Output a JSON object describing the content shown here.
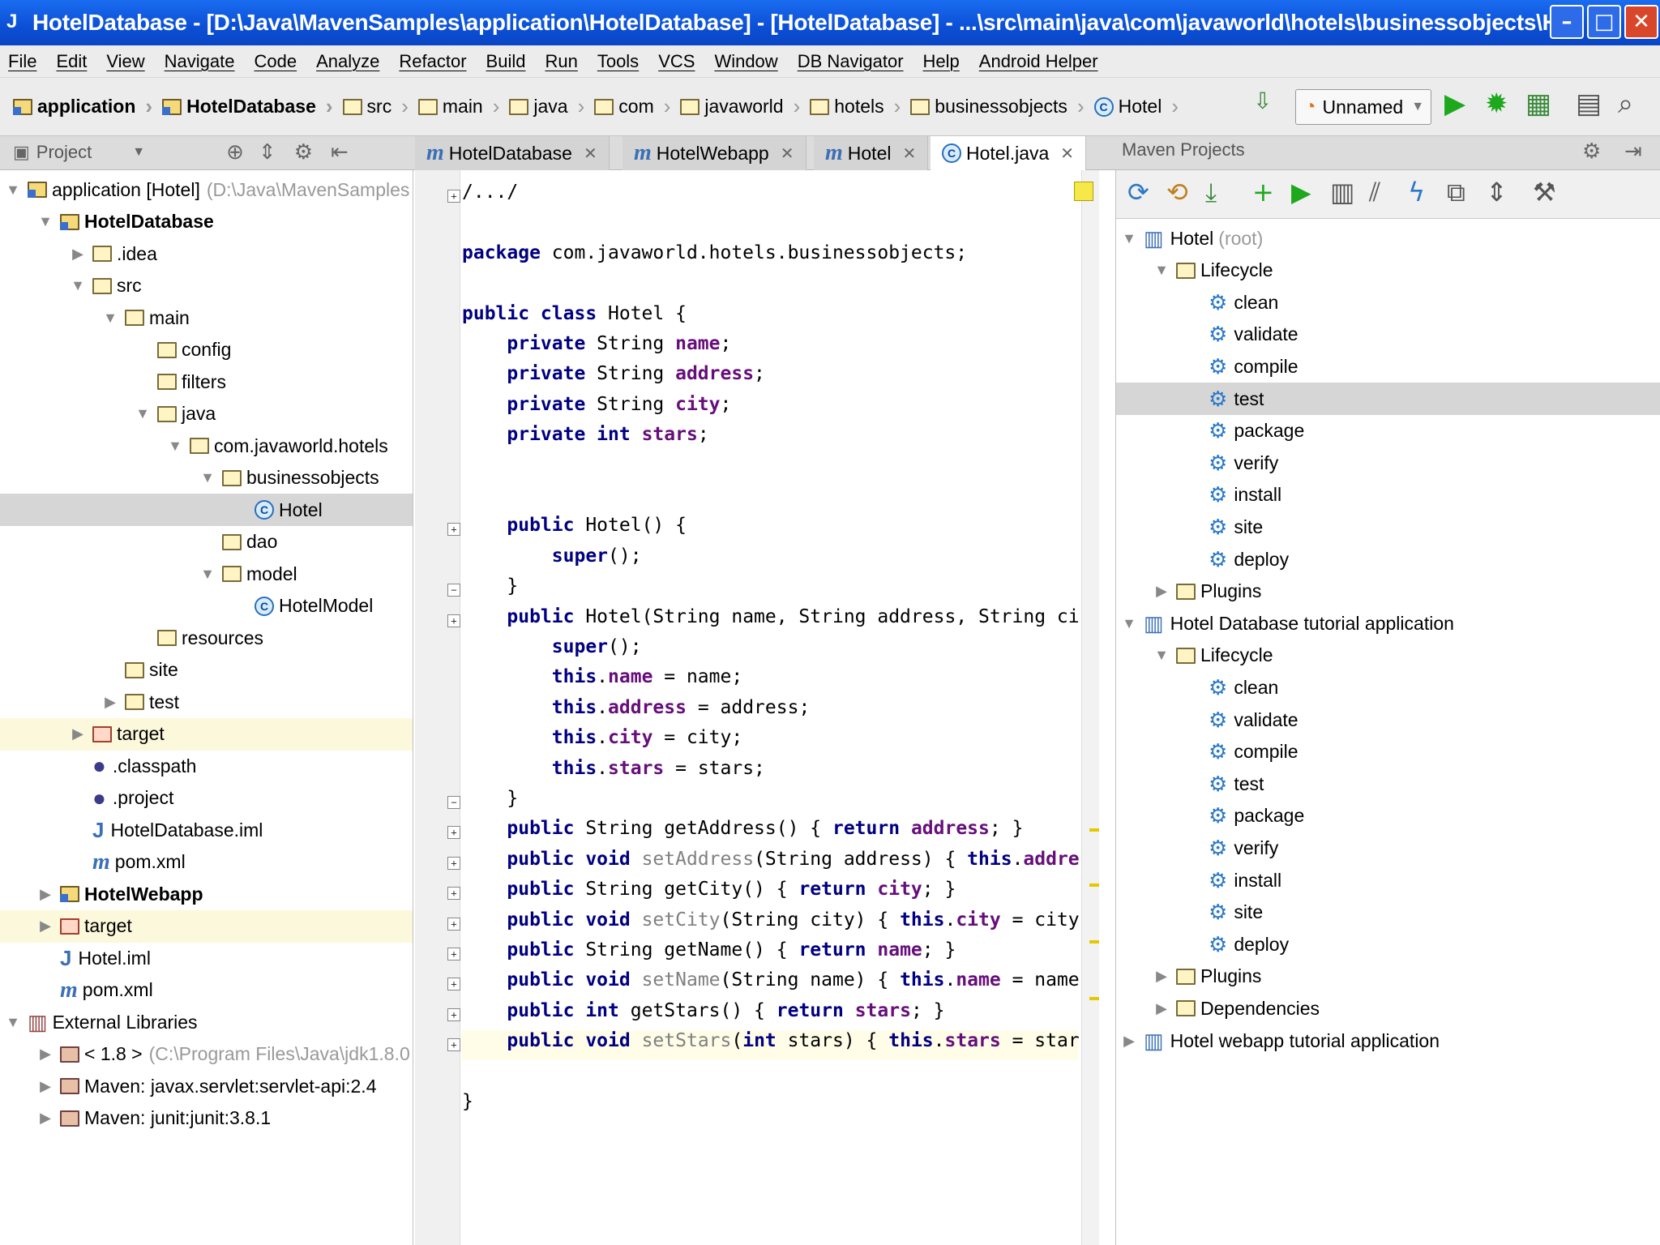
{
  "window": {
    "title": "HotelDatabase - [D:\\Java\\MavenSamples\\application\\HotelDatabase] - [HotelDatabase] - ...\\src\\main\\java\\com\\javaworld\\hotels\\businessobjects\\Hot...",
    "minimize": "–",
    "maximize": "□",
    "close": "✕"
  },
  "menu": [
    "File",
    "Edit",
    "View",
    "Navigate",
    "Code",
    "Analyze",
    "Refactor",
    "Build",
    "Run",
    "Tools",
    "VCS",
    "Window",
    "DB Navigator",
    "Help",
    "Android Helper"
  ],
  "breadcrumbs": [
    "application",
    "HotelDatabase",
    "src",
    "main",
    "java",
    "com",
    "javaworld",
    "hotels",
    "businessobjects",
    "Hotel"
  ],
  "run_config": "Unnamed",
  "project_panel": {
    "title": "Project"
  },
  "tabs": [
    {
      "label": "HotelDatabase",
      "icon": "maven-m"
    },
    {
      "label": "HotelWebapp",
      "icon": "maven-m"
    },
    {
      "label": "Hotel",
      "icon": "maven-m"
    },
    {
      "label": "Hotel.java",
      "icon": "class-c"
    }
  ],
  "maven_panel": {
    "title": "Maven Projects"
  },
  "tree": [
    {
      "label": "application [Hotel]",
      "extra": "(D:\\Java\\MavenSamples",
      "indent": 0,
      "arrow": "open",
      "icon": "module-folder"
    },
    {
      "label": "HotelDatabase",
      "indent": 1,
      "arrow": "open",
      "icon": "module-folder",
      "bold": true
    },
    {
      "label": ".idea",
      "indent": 2,
      "arrow": "closed",
      "icon": "folder"
    },
    {
      "label": "src",
      "indent": 2,
      "arrow": "open",
      "icon": "folder"
    },
    {
      "label": "main",
      "indent": 3,
      "arrow": "open",
      "icon": "folder"
    },
    {
      "label": "config",
      "indent": 4,
      "arrow": "none",
      "icon": "folder"
    },
    {
      "label": "filters",
      "indent": 4,
      "arrow": "none",
      "icon": "folder"
    },
    {
      "label": "java",
      "indent": 4,
      "arrow": "open",
      "icon": "folder"
    },
    {
      "label": "com.javaworld.hotels",
      "indent": 5,
      "arrow": "open",
      "icon": "folder"
    },
    {
      "label": "businessobjects",
      "indent": 6,
      "arrow": "open",
      "icon": "folder"
    },
    {
      "label": "Hotel",
      "indent": 7,
      "arrow": "none",
      "icon": "class",
      "selected": true
    },
    {
      "label": "dao",
      "indent": 6,
      "arrow": "none",
      "icon": "folder"
    },
    {
      "label": "model",
      "indent": 6,
      "arrow": "open",
      "icon": "folder"
    },
    {
      "label": "HotelModel",
      "indent": 7,
      "arrow": "none",
      "icon": "class"
    },
    {
      "label": "resources",
      "indent": 4,
      "arrow": "none",
      "icon": "folder"
    },
    {
      "label": "site",
      "indent": 3,
      "arrow": "none",
      "icon": "folder"
    },
    {
      "label": "test",
      "indent": 3,
      "arrow": "closed",
      "icon": "folder"
    },
    {
      "label": "target",
      "indent": 2,
      "arrow": "closed",
      "icon": "red-folder",
      "highlight": true
    },
    {
      "label": ".classpath",
      "indent": 2,
      "arrow": "none",
      "icon": "eclipse"
    },
    {
      "label": ".project",
      "indent": 2,
      "arrow": "none",
      "icon": "eclipse"
    },
    {
      "label": "HotelDatabase.iml",
      "indent": 2,
      "arrow": "none",
      "icon": "iml"
    },
    {
      "label": "pom.xml",
      "indent": 2,
      "arrow": "none",
      "icon": "maven"
    },
    {
      "label": "HotelWebapp",
      "indent": 1,
      "arrow": "closed",
      "icon": "module-folder",
      "bold": true
    },
    {
      "label": "target",
      "indent": 1,
      "arrow": "closed",
      "icon": "red-folder",
      "highlight": true
    },
    {
      "label": "Hotel.iml",
      "indent": 1,
      "arrow": "none",
      "icon": "iml"
    },
    {
      "label": "pom.xml",
      "indent": 1,
      "arrow": "none",
      "icon": "maven"
    },
    {
      "label": "External Libraries",
      "indent": 0,
      "arrow": "open",
      "icon": "libs"
    },
    {
      "label": "< 1.8 >",
      "extra": "(C:\\Program Files\\Java\\jdk1.8.0",
      "indent": 1,
      "arrow": "closed",
      "icon": "lib"
    },
    {
      "label": "Maven: javax.servlet:servlet-api:2.4",
      "indent": 1,
      "arrow": "closed",
      "icon": "lib"
    },
    {
      "label": "Maven: junit:junit:3.8.1",
      "indent": 1,
      "arrow": "closed",
      "icon": "lib"
    }
  ],
  "code": [
    [
      [
        "p",
        "/.../"
      ]
    ],
    [],
    [
      [
        "k",
        "package"
      ],
      [
        "p",
        " com.javaworld.hotels.businessobjects;"
      ]
    ],
    [],
    [
      [
        "k",
        "public class"
      ],
      [
        "p",
        " Hotel {"
      ]
    ],
    [
      [
        "p",
        "    "
      ],
      [
        "k",
        "private"
      ],
      [
        "p",
        " String "
      ],
      [
        "f",
        "name"
      ],
      [
        "p",
        ";"
      ]
    ],
    [
      [
        "p",
        "    "
      ],
      [
        "k",
        "private"
      ],
      [
        "p",
        " String "
      ],
      [
        "f",
        "address"
      ],
      [
        "p",
        ";"
      ]
    ],
    [
      [
        "p",
        "    "
      ],
      [
        "k",
        "private"
      ],
      [
        "p",
        " String "
      ],
      [
        "f",
        "city"
      ],
      [
        "p",
        ";"
      ]
    ],
    [
      [
        "p",
        "    "
      ],
      [
        "k",
        "private int"
      ],
      [
        "p",
        " "
      ],
      [
        "f",
        "stars"
      ],
      [
        "p",
        ";"
      ]
    ],
    [],
    [],
    [
      [
        "p",
        "    "
      ],
      [
        "k",
        "public"
      ],
      [
        "p",
        " Hotel() {"
      ]
    ],
    [
      [
        "p",
        "        "
      ],
      [
        "k",
        "super"
      ],
      [
        "p",
        "();"
      ]
    ],
    [
      [
        "p",
        "    }"
      ]
    ],
    [
      [
        "p",
        "    "
      ],
      [
        "k",
        "public"
      ],
      [
        "p",
        " Hotel(String name, String address, String ci"
      ]
    ],
    [
      [
        "p",
        "        "
      ],
      [
        "k",
        "super"
      ],
      [
        "p",
        "();"
      ]
    ],
    [
      [
        "p",
        "        "
      ],
      [
        "k",
        "this"
      ],
      [
        "p",
        "."
      ],
      [
        "f",
        "name"
      ],
      [
        "p",
        " = name;"
      ]
    ],
    [
      [
        "p",
        "        "
      ],
      [
        "k",
        "this"
      ],
      [
        "p",
        "."
      ],
      [
        "f",
        "address"
      ],
      [
        "p",
        " = address;"
      ]
    ],
    [
      [
        "p",
        "        "
      ],
      [
        "k",
        "this"
      ],
      [
        "p",
        "."
      ],
      [
        "f",
        "city"
      ],
      [
        "p",
        " = city;"
      ]
    ],
    [
      [
        "p",
        "        "
      ],
      [
        "k",
        "this"
      ],
      [
        "p",
        "."
      ],
      [
        "f",
        "stars"
      ],
      [
        "p",
        " = stars;"
      ]
    ],
    [
      [
        "p",
        "    }"
      ]
    ],
    [
      [
        "p",
        "    "
      ],
      [
        "k",
        "public"
      ],
      [
        "p",
        " String getAddress() { "
      ],
      [
        "k",
        "return"
      ],
      [
        "p",
        " "
      ],
      [
        "f",
        "address"
      ],
      [
        "p",
        "; }"
      ]
    ],
    [
      [
        "p",
        "    "
      ],
      [
        "k",
        "public void"
      ],
      [
        "p",
        " "
      ],
      [
        "d",
        "setAddress"
      ],
      [
        "p",
        "(String address) { "
      ],
      [
        "k",
        "this"
      ],
      [
        "p",
        "."
      ],
      [
        "f",
        "addre"
      ]
    ],
    [
      [
        "p",
        "    "
      ],
      [
        "k",
        "public"
      ],
      [
        "p",
        " String getCity() { "
      ],
      [
        "k",
        "return"
      ],
      [
        "p",
        " "
      ],
      [
        "f",
        "city"
      ],
      [
        "p",
        "; }"
      ]
    ],
    [
      [
        "p",
        "    "
      ],
      [
        "k",
        "public void"
      ],
      [
        "p",
        " "
      ],
      [
        "d",
        "setCity"
      ],
      [
        "p",
        "(String city) { "
      ],
      [
        "k",
        "this"
      ],
      [
        "p",
        "."
      ],
      [
        "f",
        "city"
      ],
      [
        "p",
        " = city"
      ]
    ],
    [
      [
        "p",
        "    "
      ],
      [
        "k",
        "public"
      ],
      [
        "p",
        " String getName() { "
      ],
      [
        "k",
        "return"
      ],
      [
        "p",
        " "
      ],
      [
        "f",
        "name"
      ],
      [
        "p",
        "; }"
      ]
    ],
    [
      [
        "p",
        "    "
      ],
      [
        "k",
        "public void"
      ],
      [
        "p",
        " "
      ],
      [
        "d",
        "setName"
      ],
      [
        "p",
        "(String name) { "
      ],
      [
        "k",
        "this"
      ],
      [
        "p",
        "."
      ],
      [
        "f",
        "name"
      ],
      [
        "p",
        " = name"
      ]
    ],
    [
      [
        "p",
        "    "
      ],
      [
        "k",
        "public int"
      ],
      [
        "p",
        " getStars() { "
      ],
      [
        "k",
        "return"
      ],
      [
        "p",
        " "
      ],
      [
        "f",
        "stars"
      ],
      [
        "p",
        "; }"
      ]
    ],
    [
      [
        "p",
        "    "
      ],
      [
        "k",
        "public void"
      ],
      [
        "p",
        " "
      ],
      [
        "d",
        "setStars"
      ],
      [
        "p",
        "("
      ],
      [
        "k",
        "int"
      ],
      [
        "p",
        " stars) { "
      ],
      [
        "k",
        "this"
      ],
      [
        "p",
        "."
      ],
      [
        "f",
        "stars"
      ],
      [
        "p",
        " = star"
      ]
    ],
    [],
    [
      [
        "p",
        "}"
      ]
    ]
  ],
  "maven_tree": [
    {
      "label": "Hotel",
      "extra": "(root)",
      "indent": 0,
      "arrow": "open",
      "icon": "maven-project"
    },
    {
      "label": "Lifecycle",
      "indent": 1,
      "arrow": "open",
      "icon": "lifecycle"
    },
    {
      "label": "clean",
      "indent": 2,
      "arrow": "none",
      "icon": "goal"
    },
    {
      "label": "validate",
      "indent": 2,
      "arrow": "none",
      "icon": "goal"
    },
    {
      "label": "compile",
      "indent": 2,
      "arrow": "none",
      "icon": "goal"
    },
    {
      "label": "test",
      "indent": 2,
      "arrow": "none",
      "icon": "goal",
      "selected": true
    },
    {
      "label": "package",
      "indent": 2,
      "arrow": "none",
      "icon": "goal"
    },
    {
      "label": "verify",
      "indent": 2,
      "arrow": "none",
      "icon": "goal"
    },
    {
      "label": "install",
      "indent": 2,
      "arrow": "none",
      "icon": "goal"
    },
    {
      "label": "site",
      "indent": 2,
      "arrow": "none",
      "icon": "goal"
    },
    {
      "label": "deploy",
      "indent": 2,
      "arrow": "none",
      "icon": "goal"
    },
    {
      "label": "Plugins",
      "indent": 1,
      "arrow": "closed",
      "icon": "lifecycle"
    },
    {
      "label": "Hotel Database tutorial application",
      "indent": 0,
      "arrow": "open",
      "icon": "maven-project"
    },
    {
      "label": "Lifecycle",
      "indent": 1,
      "arrow": "open",
      "icon": "lifecycle"
    },
    {
      "label": "clean",
      "indent": 2,
      "arrow": "none",
      "icon": "goal"
    },
    {
      "label": "validate",
      "indent": 2,
      "arrow": "none",
      "icon": "goal"
    },
    {
      "label": "compile",
      "indent": 2,
      "arrow": "none",
      "icon": "goal"
    },
    {
      "label": "test",
      "indent": 2,
      "arrow": "none",
      "icon": "goal"
    },
    {
      "label": "package",
      "indent": 2,
      "arrow": "none",
      "icon": "goal"
    },
    {
      "label": "verify",
      "indent": 2,
      "arrow": "none",
      "icon": "goal"
    },
    {
      "label": "install",
      "indent": 2,
      "arrow": "none",
      "icon": "goal"
    },
    {
      "label": "site",
      "indent": 2,
      "arrow": "none",
      "icon": "goal"
    },
    {
      "label": "deploy",
      "indent": 2,
      "arrow": "none",
      "icon": "goal"
    },
    {
      "label": "Plugins",
      "indent": 1,
      "arrow": "closed",
      "icon": "lifecycle"
    },
    {
      "label": "Dependencies",
      "indent": 1,
      "arrow": "closed",
      "icon": "lifecycle"
    },
    {
      "label": "Hotel webapp tutorial application",
      "indent": 0,
      "arrow": "closed",
      "icon": "maven-project"
    }
  ]
}
